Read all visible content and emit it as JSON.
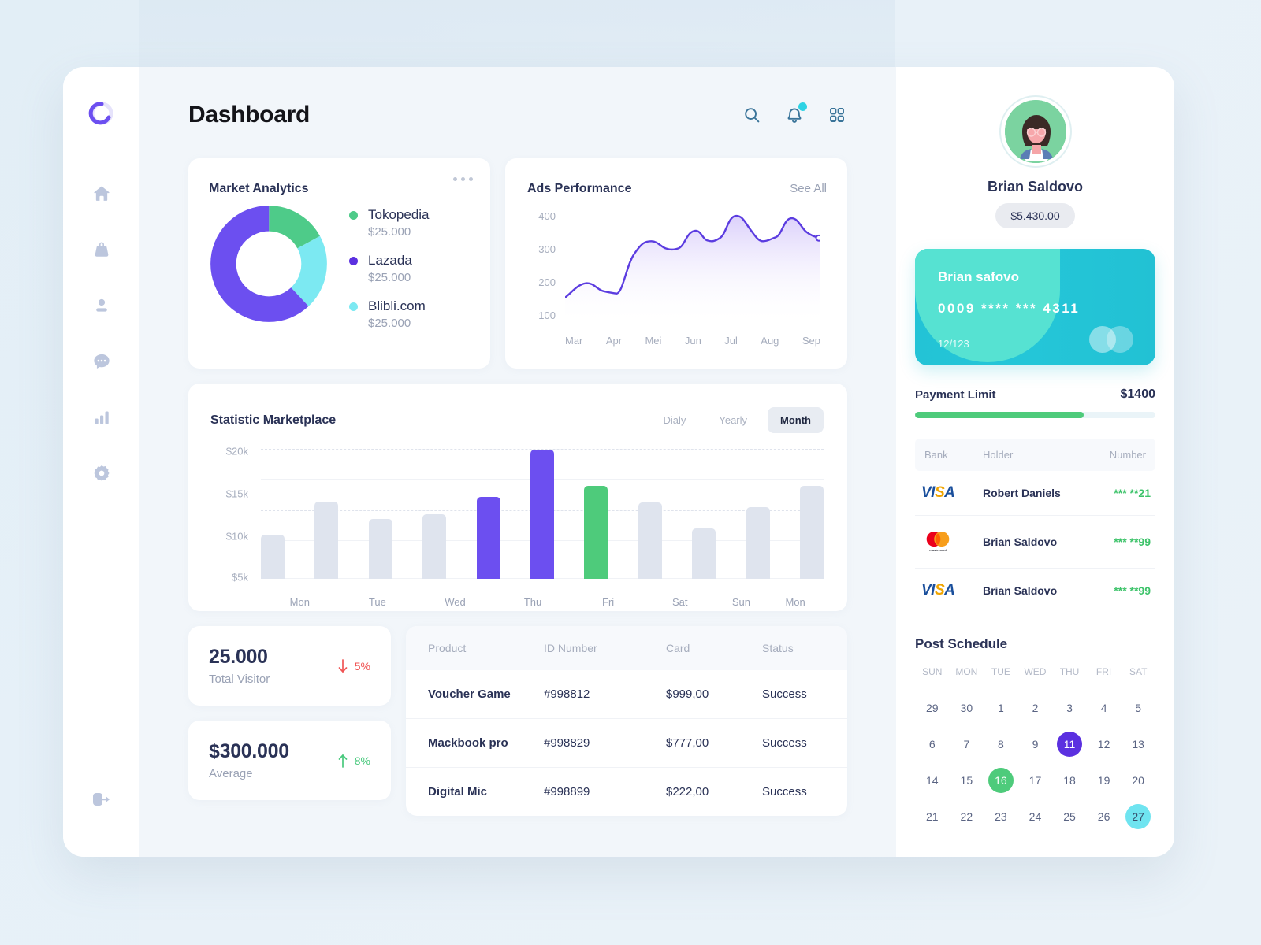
{
  "app": {
    "title": "Dashboard"
  },
  "sidebar": {
    "logo_name": "app-logo",
    "items": [
      {
        "name": "home",
        "label": "Home"
      },
      {
        "name": "bag",
        "label": "Shop"
      },
      {
        "name": "user",
        "label": "Profile"
      },
      {
        "name": "chat",
        "label": "Messages"
      },
      {
        "name": "chart",
        "label": "Statistics"
      },
      {
        "name": "gear",
        "label": "Settings"
      }
    ],
    "logout_label": "Logout"
  },
  "header": {
    "search_icon": "search-icon",
    "notification_icon": "bell-icon",
    "apps_icon": "grid-icon",
    "has_notification": true
  },
  "market": {
    "title": "Market Analytics",
    "menu_icon": "more-icon",
    "legend": [
      {
        "name": "Tokopedia",
        "value": "$25.000",
        "color": "#4ecb89"
      },
      {
        "name": "Lazada",
        "value": "$25.000",
        "color": "#5b30e0"
      },
      {
        "name": "Blibli.com",
        "value": "$25.000",
        "color": "#7ce9f2"
      }
    ]
  },
  "ads": {
    "title": "Ads Performance",
    "see_all": "See All"
  },
  "statistic": {
    "title": "Statistic Marketplace",
    "tabs": [
      {
        "label": "Dialy",
        "active": false
      },
      {
        "label": "Yearly",
        "active": false
      },
      {
        "label": "Month",
        "active": true
      }
    ]
  },
  "mini_stats": [
    {
      "value": "25.000",
      "label": "Total Visitor",
      "delta": "5%",
      "direction": "down"
    },
    {
      "value": "$300.000",
      "label": "Average",
      "delta": "8%",
      "direction": "up"
    }
  ],
  "products": {
    "columns": [
      "Product",
      "ID Number",
      "Card",
      "Status"
    ],
    "rows": [
      {
        "product": "Voucher Game",
        "id": "#998812",
        "card": "$999,00",
        "status": "Success"
      },
      {
        "product": "Mackbook pro",
        "id": "#998829",
        "card": "$777,00",
        "status": "Success"
      },
      {
        "product": "Digital Mic",
        "id": "#998899",
        "card": "$222,00",
        "status": "Success"
      }
    ]
  },
  "profile": {
    "name": "Brian Saldovo",
    "balance": "$5.430.00"
  },
  "bank_card": {
    "holder": "Brian safovo",
    "number": "0009 **** *** 4311",
    "expiry": "12/123"
  },
  "payment_limit": {
    "label": "Payment Limit",
    "value": "$1400",
    "percent": 70
  },
  "banks": {
    "columns": [
      "Bank",
      "Holder",
      "Number"
    ],
    "rows": [
      {
        "brand": "visa",
        "holder": "Robert Daniels",
        "number": "*** **21"
      },
      {
        "brand": "mastercard",
        "holder": "Brian Saldovo",
        "number": "*** **99"
      },
      {
        "brand": "visa",
        "holder": "Brian Saldovo",
        "number": "*** **99"
      }
    ]
  },
  "schedule": {
    "title": "Post Schedule",
    "weekdays": [
      "SUN",
      "MON",
      "TUE",
      "WED",
      "THU",
      "FRI",
      "SAT"
    ],
    "weeks": [
      [
        {
          "d": "29"
        },
        {
          "d": "30"
        },
        {
          "d": "1"
        },
        {
          "d": "2"
        },
        {
          "d": "3"
        },
        {
          "d": "4"
        },
        {
          "d": "5"
        }
      ],
      [
        {
          "d": "6"
        },
        {
          "d": "7"
        },
        {
          "d": "8"
        },
        {
          "d": "9"
        },
        {
          "d": "11",
          "hl": "purple"
        },
        {
          "d": "12"
        },
        {
          "d": "13"
        }
      ],
      [
        {
          "d": "14"
        },
        {
          "d": "15"
        },
        {
          "d": "16",
          "hl": "green"
        },
        {
          "d": "17"
        },
        {
          "d": "18"
        },
        {
          "d": "19"
        },
        {
          "d": "20"
        }
      ],
      [
        {
          "d": "21"
        },
        {
          "d": "22"
        },
        {
          "d": "23"
        },
        {
          "d": "24"
        },
        {
          "d": "25"
        },
        {
          "d": "26"
        },
        {
          "d": "27",
          "hl": "cyan"
        }
      ]
    ]
  },
  "colors": {
    "purple": "#5b30e0",
    "purple_light": "#6c4ff0",
    "green": "#4ecb7b",
    "cyan": "#6fe4f0",
    "bar_grey": "#dfe4ee",
    "red": "#f05454",
    "ink": "#2a3256"
  },
  "chart_data": [
    {
      "type": "pie",
      "title": "Market Analytics",
      "labels": [
        "Tokopedia",
        "Lazada",
        "Blibli.com"
      ],
      "values": [
        25000,
        25000,
        25000
      ],
      "display_values": [
        "$25.000",
        "$25.000",
        "$25.000"
      ],
      "slice_fractions": [
        0.17,
        0.62,
        0.21
      ],
      "colors": [
        "#4ecb89",
        "#6c4ff0",
        "#7ce9f2"
      ],
      "donut": true,
      "legend": "right"
    },
    {
      "type": "area",
      "title": "Ads Performance",
      "x": [
        "Mar",
        "Apr",
        "Mei",
        "Jun",
        "Jul",
        "Aug",
        "Sep"
      ],
      "ylabel": "",
      "xlabel": "",
      "yticks": [
        400,
        300,
        200,
        100
      ],
      "ylim": [
        100,
        430
      ],
      "grid": false,
      "series": [
        {
          "name": "Ads",
          "color": "#5b3ce0",
          "values": [
            158,
            180,
            163,
            272,
            253,
            302,
            287,
            345,
            302,
            388,
            287,
            330,
            308
          ],
          "x_dense": [
            "Mar",
            "",
            "Apr",
            "",
            "Mei",
            "",
            "Jun",
            "",
            "Jul",
            "",
            "Aug",
            "",
            "Sep"
          ]
        }
      ],
      "marker_last": true
    },
    {
      "type": "bar",
      "title": "Statistic Marketplace",
      "categories": [
        "Mon",
        "Tue",
        "Wed",
        "Thu",
        "Fri",
        "Sat",
        "Sun",
        "Mon",
        ""
      ],
      "bar_labels": [
        "Mon",
        "",
        "Tue",
        "Wed",
        "Thu",
        "Thu2",
        "Fri",
        "Sat",
        "Sun",
        "Mon",
        ""
      ],
      "values": [
        9.5,
        14,
        11.5,
        12,
        14.5,
        20.5,
        16,
        14,
        10,
        13.5,
        16
      ],
      "value_unit": "k USD",
      "yticks": [
        "$20k",
        "$15k",
        "$10k",
        "$5k"
      ],
      "ytick_values": [
        20,
        15,
        10,
        5
      ],
      "ylim": [
        3.5,
        21.5
      ],
      "bar_colors": [
        "#dfe4ee",
        "#dfe4ee",
        "#dfe4ee",
        "#dfe4ee",
        "#6c4ff0",
        "#6c4ff0",
        "#4ecb7b",
        "#dfe4ee",
        "#dfe4ee",
        "#dfe4ee",
        "#dfe4ee"
      ],
      "grid": true,
      "legend": "none"
    }
  ]
}
